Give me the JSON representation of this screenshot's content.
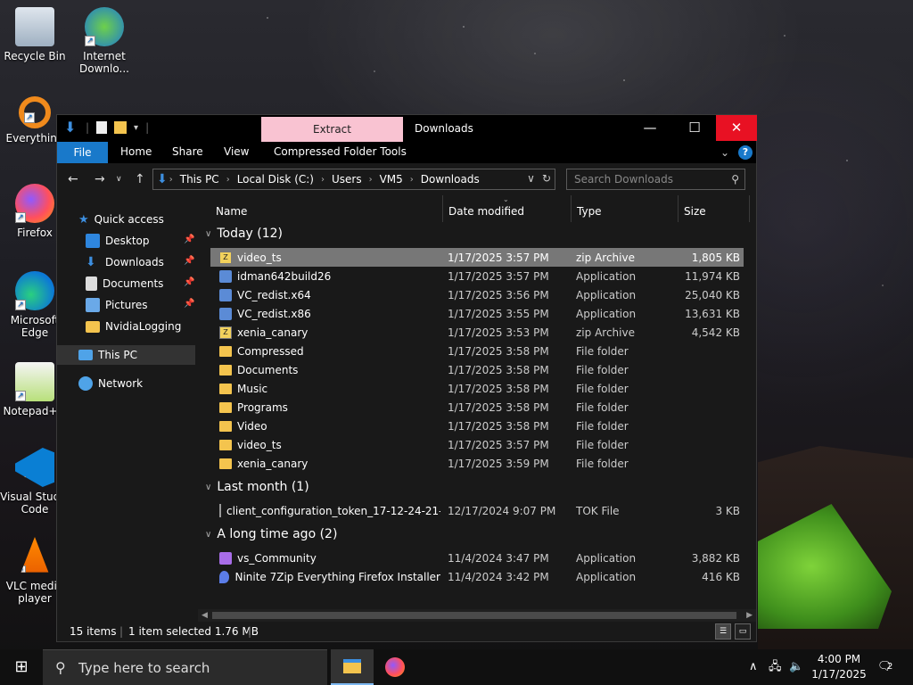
{
  "desktop": {
    "icons": [
      {
        "label": "Recycle Bin"
      },
      {
        "label": "Internet Downlo..."
      },
      {
        "label": "Everything"
      },
      {
        "label": "Firefox"
      },
      {
        "label": "Microsoft Edge"
      },
      {
        "label": "Notepad++"
      },
      {
        "label": "Visual Studio Code"
      },
      {
        "label": "VLC media player"
      }
    ]
  },
  "window": {
    "title": "Downloads",
    "context_tab": "Extract",
    "ribbon_tabs": [
      "File",
      "Home",
      "Share",
      "View",
      "Compressed Folder Tools"
    ],
    "controls": {
      "minimize": "—",
      "maximize": "☐",
      "close": "✕"
    }
  },
  "address": {
    "crumbs": [
      "This PC",
      "Local Disk (C:)",
      "Users",
      "VM5",
      "Downloads"
    ],
    "search_placeholder": "Search Downloads"
  },
  "navpane": {
    "quick_access": "Quick access",
    "items": [
      {
        "label": "Desktop",
        "pinned": true
      },
      {
        "label": "Downloads",
        "pinned": true
      },
      {
        "label": "Documents",
        "pinned": true
      },
      {
        "label": "Pictures",
        "pinned": true
      },
      {
        "label": "NvidiaLogging",
        "pinned": false
      }
    ],
    "this_pc": "This PC",
    "network": "Network"
  },
  "columns": {
    "name": "Name",
    "date": "Date modified",
    "type": "Type",
    "size": "Size"
  },
  "groups": [
    {
      "title": "Today (12)",
      "rows": [
        {
          "name": "video_ts",
          "date": "1/17/2025 3:57 PM",
          "type": "zip Archive",
          "size": "1,805 KB",
          "icon": "zip",
          "selected": true
        },
        {
          "name": "idman642build26",
          "date": "1/17/2025 3:57 PM",
          "type": "Application",
          "size": "11,974 KB",
          "icon": "app"
        },
        {
          "name": "VC_redist.x64",
          "date": "1/17/2025 3:56 PM",
          "type": "Application",
          "size": "25,040 KB",
          "icon": "app"
        },
        {
          "name": "VC_redist.x86",
          "date": "1/17/2025 3:55 PM",
          "type": "Application",
          "size": "13,631 KB",
          "icon": "app"
        },
        {
          "name": "xenia_canary",
          "date": "1/17/2025 3:53 PM",
          "type": "zip Archive",
          "size": "4,542 KB",
          "icon": "zip"
        },
        {
          "name": "Compressed",
          "date": "1/17/2025 3:58 PM",
          "type": "File folder",
          "size": "",
          "icon": "folder"
        },
        {
          "name": "Documents",
          "date": "1/17/2025 3:58 PM",
          "type": "File folder",
          "size": "",
          "icon": "folder"
        },
        {
          "name": "Music",
          "date": "1/17/2025 3:58 PM",
          "type": "File folder",
          "size": "",
          "icon": "folder"
        },
        {
          "name": "Programs",
          "date": "1/17/2025 3:58 PM",
          "type": "File folder",
          "size": "",
          "icon": "folder"
        },
        {
          "name": "Video",
          "date": "1/17/2025 3:58 PM",
          "type": "File folder",
          "size": "",
          "icon": "folder"
        },
        {
          "name": "video_ts",
          "date": "1/17/2025 3:57 PM",
          "type": "File folder",
          "size": "",
          "icon": "folder"
        },
        {
          "name": "xenia_canary",
          "date": "1/17/2025 3:59 PM",
          "type": "File folder",
          "size": "",
          "icon": "folder"
        }
      ]
    },
    {
      "title": "Last month (1)",
      "rows": [
        {
          "name": "client_configuration_token_17-12-24-21-...",
          "date": "12/17/2024 9:07 PM",
          "type": "TOK File",
          "size": "3 KB",
          "icon": "doc"
        }
      ]
    },
    {
      "title": "A long time ago (2)",
      "rows": [
        {
          "name": "vs_Community",
          "date": "11/4/2024 3:47 PM",
          "type": "Application",
          "size": "3,882 KB",
          "icon": "vs"
        },
        {
          "name": "Ninite 7Zip Everything Firefox Installer",
          "date": "11/4/2024 3:42 PM",
          "type": "Application",
          "size": "416 KB",
          "icon": "ninite"
        }
      ]
    }
  ],
  "status": {
    "count": "15 items",
    "selected": "1 item selected  1.76 MB"
  },
  "taskbar": {
    "search_placeholder": "Type here to search",
    "time": "4:00 PM",
    "date": "1/17/2025",
    "notifications": "2"
  },
  "colors": {
    "accent": "#1979ca",
    "close": "#e81123",
    "context_tab": "#f9c3d2",
    "folder": "#f4c44e"
  }
}
